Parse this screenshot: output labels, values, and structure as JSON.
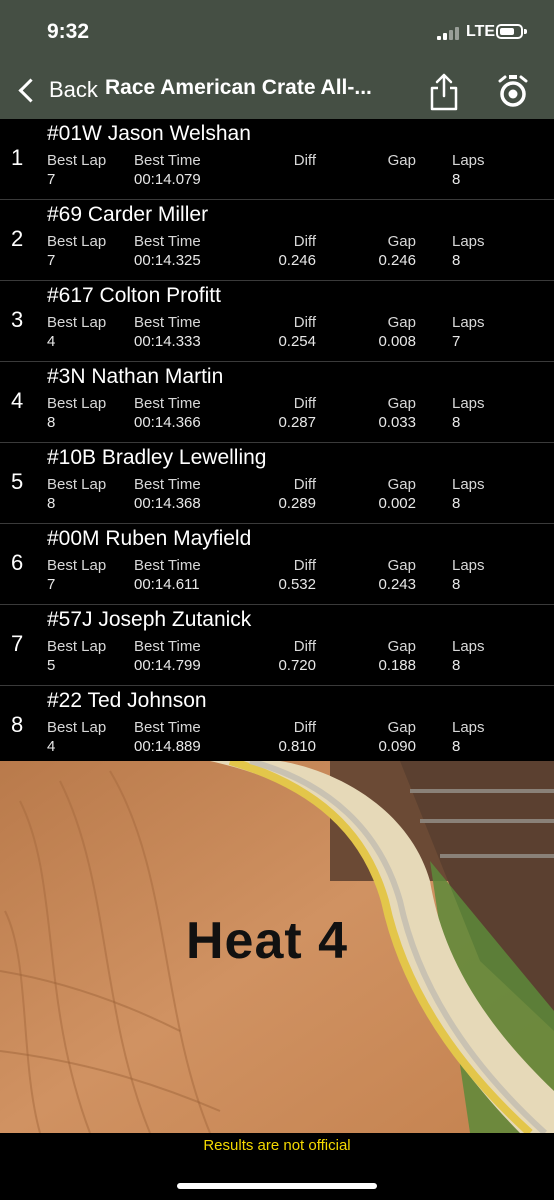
{
  "status_bar": {
    "time": "9:32",
    "network": "LTE"
  },
  "nav": {
    "back_label": "Back",
    "title": "Race American Crate All-..."
  },
  "columns": {
    "best_lap": "Best Lap",
    "best_time": "Best Time",
    "diff": "Diff",
    "gap": "Gap",
    "laps": "Laps"
  },
  "results": [
    {
      "pos": "1",
      "driver": "#01W Jason Welshan",
      "best_lap": "7",
      "best_time": "00:14.079",
      "diff": "",
      "gap": "",
      "laps": "8"
    },
    {
      "pos": "2",
      "driver": "#69 Carder Miller",
      "best_lap": "7",
      "best_time": "00:14.325",
      "diff": "0.246",
      "gap": "0.246",
      "laps": "8"
    },
    {
      "pos": "3",
      "driver": "#617 Colton Profitt",
      "best_lap": "4",
      "best_time": "00:14.333",
      "diff": "0.254",
      "gap": "0.008",
      "laps": "7"
    },
    {
      "pos": "4",
      "driver": "#3N Nathan Martin",
      "best_lap": "8",
      "best_time": "00:14.366",
      "diff": "0.287",
      "gap": "0.033",
      "laps": "8"
    },
    {
      "pos": "5",
      "driver": "#10B Bradley Lewelling",
      "best_lap": "8",
      "best_time": "00:14.368",
      "diff": "0.289",
      "gap": "0.002",
      "laps": "8"
    },
    {
      "pos": "6",
      "driver": "#00M Ruben Mayfield",
      "best_lap": "7",
      "best_time": "00:14.611",
      "diff": "0.532",
      "gap": "0.243",
      "laps": "8"
    },
    {
      "pos": "7",
      "driver": "#57J Joseph Zutanick",
      "best_lap": "5",
      "best_time": "00:14.799",
      "diff": "0.720",
      "gap": "0.188",
      "laps": "8"
    },
    {
      "pos": "8",
      "driver": "#22 Ted Johnson",
      "best_lap": "4",
      "best_time": "00:14.889",
      "diff": "0.810",
      "gap": "0.090",
      "laps": "8"
    }
  ],
  "banner": {
    "text": "Heat 4"
  },
  "footer": {
    "notice": "Results are not official"
  },
  "colors": {
    "nav_bg": "#454f44",
    "notice": "#f5d900",
    "track_dirt": "#c98a55"
  }
}
